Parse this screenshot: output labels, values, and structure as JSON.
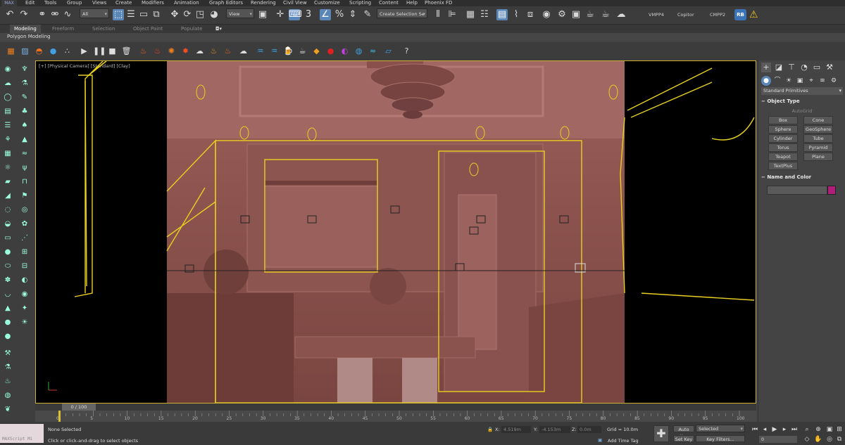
{
  "menubar": {
    "logo": "MAX",
    "items": [
      "Edit",
      "Tools",
      "Group",
      "Views",
      "Create",
      "Modifiers",
      "Animation",
      "Graph Editors",
      "Rendering",
      "Civil View",
      "Customize",
      "Scripting",
      "Content",
      "Help",
      "Phoenix FD"
    ]
  },
  "toolbar": {
    "selection_filter": "All",
    "ref_coord": "View",
    "snap_count": "3",
    "named_selection": "Create Selection Se",
    "workspace_labels": [
      "VMPP4",
      "Copitor",
      "CMPP2"
    ],
    "user_badge": "RB"
  },
  "ribbon": {
    "tabs": [
      "Modeling",
      "Freeform",
      "Selection",
      "Object Paint",
      "Populate"
    ],
    "active_tab": "Modeling",
    "sub_label": "Polygon Modeling"
  },
  "viewport": {
    "label": "[+] [Physical Camera] [Standard] [Clay]"
  },
  "command_panel": {
    "category": "Standard Primitives",
    "object_type_title": "Object Type",
    "autogrid": "AutoGrid",
    "primitives": [
      "Box",
      "Cone",
      "Sphere",
      "GeoSphere",
      "Cylinder",
      "Tube",
      "Torus",
      "Pyramid",
      "Teapot",
      "Plane",
      "TextPlus"
    ],
    "name_color_title": "Name and Color",
    "object_color": "#b01e79"
  },
  "timeline": {
    "frame_display": "0 / 100",
    "current_frame": 0,
    "total_frames": 100,
    "ticks": [
      "0",
      "5",
      "10",
      "15",
      "20",
      "25",
      "30",
      "35",
      "40",
      "45",
      "50",
      "55",
      "60",
      "65",
      "70",
      "75",
      "80",
      "85",
      "90",
      "95",
      "100"
    ]
  },
  "status": {
    "maxscript_label": "MAXScript Mi",
    "selection_state": "None Selected",
    "prompt": "Click or click-and-drag to select objects",
    "x_label": "X:",
    "x_value": "4.519m",
    "y_label": "Y:",
    "y_value": "-4.153m",
    "z_label": "Z:",
    "z_value": "0.0m",
    "grid": "Grid = 10.0m",
    "add_time_tag": "Add Time Tag",
    "auto_key": "Auto Key",
    "set_key": "Set Key",
    "key_mode": "Selected",
    "key_filters": "Key Filters...",
    "frame_field": "0"
  }
}
